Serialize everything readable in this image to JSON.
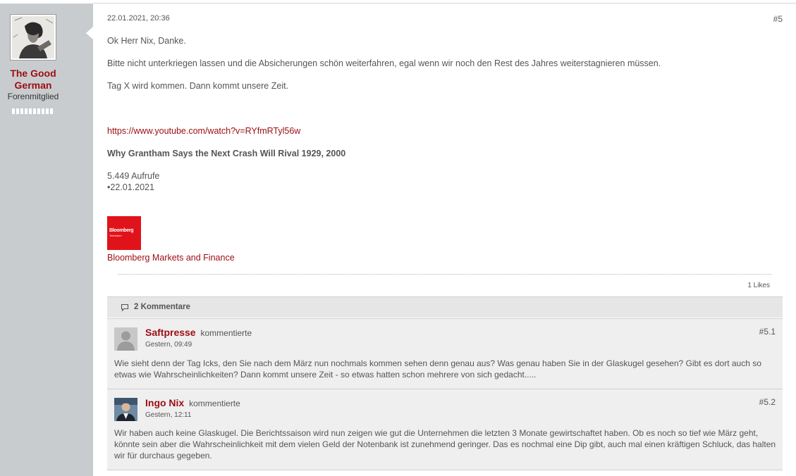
{
  "author": {
    "name": "The Good German",
    "rank": "Forenmitglied"
  },
  "post": {
    "date": "22.01.2021, 20:36",
    "number": "#5",
    "lines": [
      "Ok Herr Nix, Danke.",
      "Bitte nicht unterkriegen lassen und die Absicherungen schön weiterfahren, egal wenn wir noch den Rest des Jahres weiterstagnieren müssen.",
      "Tag X wird kommen. Dann kommt unsere Zeit."
    ],
    "link": "https://www.youtube.com/watch?v=RYfmRTyl56w",
    "video_title": "Why Grantham Says the Next Crash Will Rival 1929, 2000",
    "views": "5.449 Aufrufe",
    "video_date": "•22.01.2021",
    "channel_logo_text": "Bloomberg",
    "channel_logo_subtext": "Television",
    "channel_name": "Bloomberg Markets and Finance",
    "likes": "1 Likes"
  },
  "comments_header": "2 Kommentare",
  "comments": [
    {
      "author": "Saftpresse",
      "verb": "kommentierte",
      "time": "Gestern, 09:49",
      "number": "#5.1",
      "text": "Wie sieht denn der Tag Icks, den Sie nach dem März nun nochmals kommen sehen denn genau aus? Was genau haben Sie in der Glaskugel gesehen? Gibt es dort auch so etwas wie Wahrscheinlichkeiten? Dann kommt unsere Zeit - so etwas hatten schon mehrere von sich gedacht....."
    },
    {
      "author": "Ingo Nix",
      "verb": "kommentierte",
      "time": "Gestern, 12:11",
      "number": "#5.2",
      "text": "Wir haben auch keine Glaskugel. Die Berichtssaison wird nun zeigen wie gut die Unternehmen die letzten 3 Monate gewirtschaftet haben. Ob es noch so tief wie März geht, könnte sein aber die Wahrscheinlichkeit mit dem vielen Geld der Notenbank ist zunehmend geringer. Das es nochmal eine Dip gibt, auch mal einen kräftigen Schluck, das halten wir für durchaus gegeben."
    }
  ],
  "colors": {
    "accent": "#9b0d12",
    "sidebar": "#c9ccce",
    "bloomberg": "#e1131a"
  },
  "icons": {
    "comments": "speech-bubble-icon"
  }
}
